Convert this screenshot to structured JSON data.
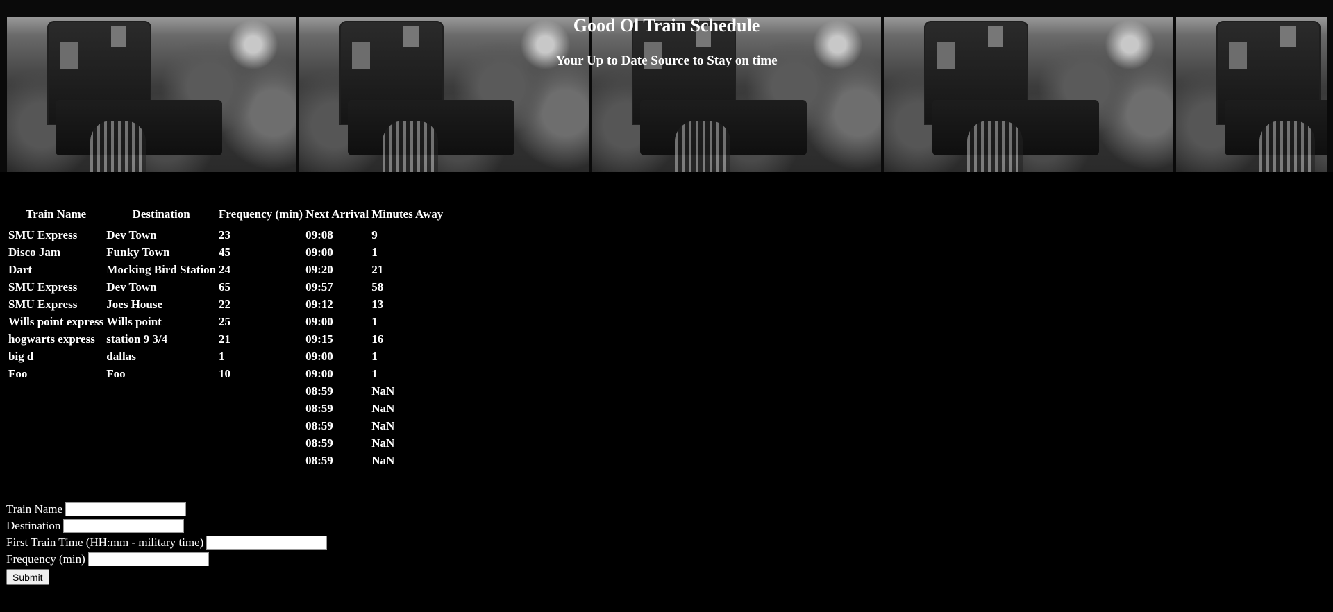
{
  "header": {
    "title": "Good Ol Train Schedule",
    "subtitle": "Your Up to Date Source to Stay on time"
  },
  "table": {
    "columns": [
      "Train Name",
      "Destination",
      "Frequency (min)",
      "Next Arrival",
      "Minutes Away"
    ],
    "rows": [
      [
        "SMU Express",
        "Dev Town",
        "23",
        "09:08",
        "9"
      ],
      [
        "Disco Jam",
        "Funky Town",
        "45",
        "09:00",
        "1"
      ],
      [
        "Dart",
        "Mocking Bird Station",
        "24",
        "09:20",
        "21"
      ],
      [
        "SMU Express",
        "Dev Town",
        "65",
        "09:57",
        "58"
      ],
      [
        "SMU Express",
        "Joes House",
        "22",
        "09:12",
        "13"
      ],
      [
        "Wills point express",
        "Wills point",
        "25",
        "09:00",
        "1"
      ],
      [
        "hogwarts express",
        "station 9 3/4",
        "21",
        "09:15",
        "16"
      ],
      [
        "big d",
        "dallas",
        "1",
        "09:00",
        "1"
      ],
      [
        "Foo",
        "Foo",
        "10",
        "09:00",
        "1"
      ],
      [
        "",
        "",
        "",
        "08:59",
        "NaN"
      ],
      [
        "",
        "",
        "",
        "08:59",
        "NaN"
      ],
      [
        "",
        "",
        "",
        "08:59",
        "NaN"
      ],
      [
        "",
        "",
        "",
        "08:59",
        "NaN"
      ],
      [
        "",
        "",
        "",
        "08:59",
        "NaN"
      ]
    ]
  },
  "form": {
    "train_name_label": "Train Name",
    "destination_label": "Destination",
    "first_train_time_label": "First Train Time (HH:mm - military time)",
    "frequency_label": "Frequency (min)",
    "submit_label": "Submit",
    "train_name_value": "",
    "destination_value": "",
    "first_train_time_value": "",
    "frequency_value": ""
  }
}
